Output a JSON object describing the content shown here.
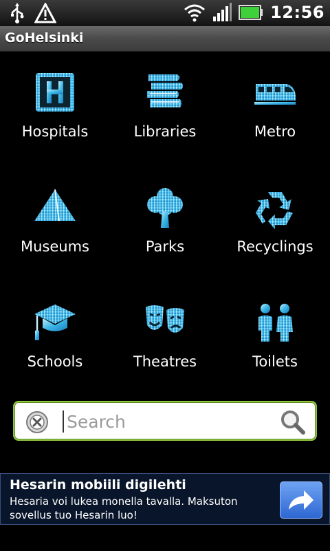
{
  "status_bar": {
    "time": "12:56",
    "icons": [
      "usb-icon",
      "warning-icon",
      "wifi-icon",
      "signal-icon",
      "battery-icon"
    ]
  },
  "app": {
    "title": "GoHelsinki"
  },
  "categories": [
    {
      "label": "Hospitals",
      "icon": "hospital-icon"
    },
    {
      "label": "Libraries",
      "icon": "books-icon"
    },
    {
      "label": "Metro",
      "icon": "train-icon"
    },
    {
      "label": "Museums",
      "icon": "pyramid-icon"
    },
    {
      "label": "Parks",
      "icon": "tree-icon"
    },
    {
      "label": "Recyclings",
      "icon": "recycle-icon"
    },
    {
      "label": "Schools",
      "icon": "graduation-cap-icon"
    },
    {
      "label": "Theatres",
      "icon": "theatre-masks-icon"
    },
    {
      "label": "Toilets",
      "icon": "toilets-icon"
    }
  ],
  "search": {
    "placeholder": "Search",
    "value": ""
  },
  "ad": {
    "headline": "Hesarin mobiili digilehti",
    "body": "Hesaria voi lukea monella tavalla. Maksuton sovellus tuo Hesarin luo!"
  },
  "colors": {
    "icon_accent": "#39b8e8",
    "search_border": "#8dc63f",
    "ad_background": "#09152a",
    "ad_button": "#4a86e8"
  }
}
